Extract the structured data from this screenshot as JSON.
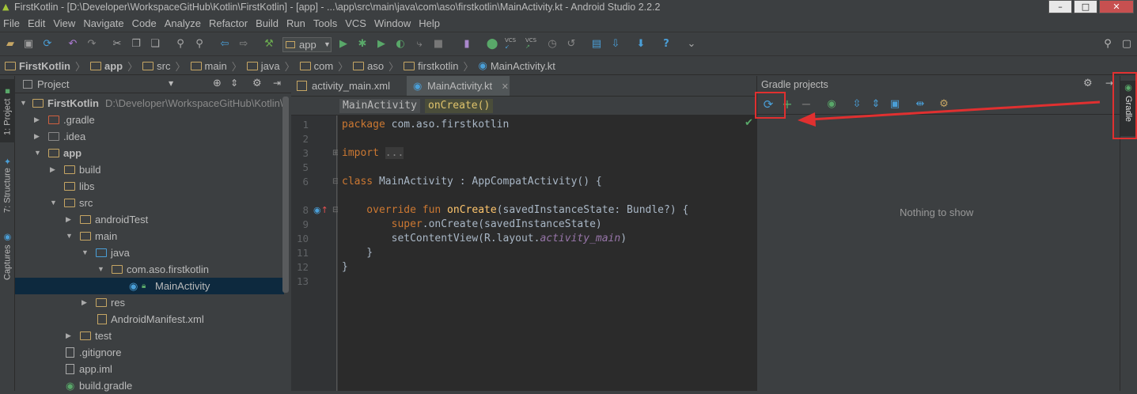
{
  "window": {
    "title": "FirstKotlin - [D:\\Developer\\WorkspaceGitHub\\Kotlin\\FirstKotlin] - [app] - ...\\app\\src\\main\\java\\com\\aso\\firstkotlin\\MainActivity.kt - Android Studio 2.2.2"
  },
  "menu": [
    "File",
    "Edit",
    "View",
    "Navigate",
    "Code",
    "Analyze",
    "Refactor",
    "Build",
    "Run",
    "Tools",
    "VCS",
    "Window",
    "Help"
  ],
  "toolbar": {
    "run_config": "app",
    "vcs1": "VCS",
    "vcs2": "VCS",
    "help": "?"
  },
  "breadcrumbs": [
    "FirstKotlin",
    "app",
    "src",
    "main",
    "java",
    "com",
    "aso",
    "firstkotlin",
    "MainActivity.kt"
  ],
  "left_strip": {
    "project_tab": "1: Project",
    "structure_tab": "7: Structure",
    "captures_tab": "Captures"
  },
  "project_panel": {
    "view_selector": "Project",
    "tree": [
      {
        "label": "FirstKotlin",
        "path": "D:\\Developer\\WorkspaceGitHub\\Kotlin\\F",
        "bold": true
      },
      {
        "label": ".gradle"
      },
      {
        "label": ".idea"
      },
      {
        "label": "app",
        "bold": true
      },
      {
        "label": "build"
      },
      {
        "label": "libs"
      },
      {
        "label": "src"
      },
      {
        "label": "androidTest"
      },
      {
        "label": "main"
      },
      {
        "label": "java"
      },
      {
        "label": "com.aso.firstkotlin"
      },
      {
        "label": "MainActivity"
      },
      {
        "label": "res"
      },
      {
        "label": "AndroidManifest.xml"
      },
      {
        "label": "test"
      },
      {
        "label": ".gitignore"
      },
      {
        "label": "app.iml"
      },
      {
        "label": "build.gradle"
      }
    ]
  },
  "editor": {
    "tabs": [
      {
        "label": "activity_main.xml",
        "active": false
      },
      {
        "label": "MainActivity.kt",
        "active": true
      }
    ],
    "crumbs": [
      "MainActivity",
      "onCreate()"
    ],
    "line_numbers": [
      "1",
      "2",
      "3",
      "5",
      "6",
      "8",
      "9",
      "10",
      "11",
      "12",
      "13"
    ],
    "code": {
      "l1_kw": "package",
      "l1_rest": " com.aso.firstkotlin",
      "l3_kw": "import",
      "l3_fold": "...",
      "l5_kw": "class",
      "l5_rest": " MainActivity : AppCompatActivity() {",
      "l8_kw1": "    override",
      "l8_kw2": " fun",
      "l8_fn": " onCreate",
      "l8_rest": "(savedInstanceState: Bundle?) {",
      "l9_kw": "        super",
      "l9_rest": ".onCreate(savedInstanceState)",
      "l10_a": "        setContentView(R.layout.",
      "l10_it": "activity_main",
      "l10_b": ")",
      "l11": "    }",
      "l12": "}"
    }
  },
  "gradle_panel": {
    "title": "Gradle projects",
    "empty_text": "Nothing to show"
  },
  "right_strip": {
    "gradle_tab": "Gradle"
  },
  "colors": {
    "highlight": "#e03030",
    "selection": "#0d293e",
    "editor_bg": "#2b2b2b"
  }
}
